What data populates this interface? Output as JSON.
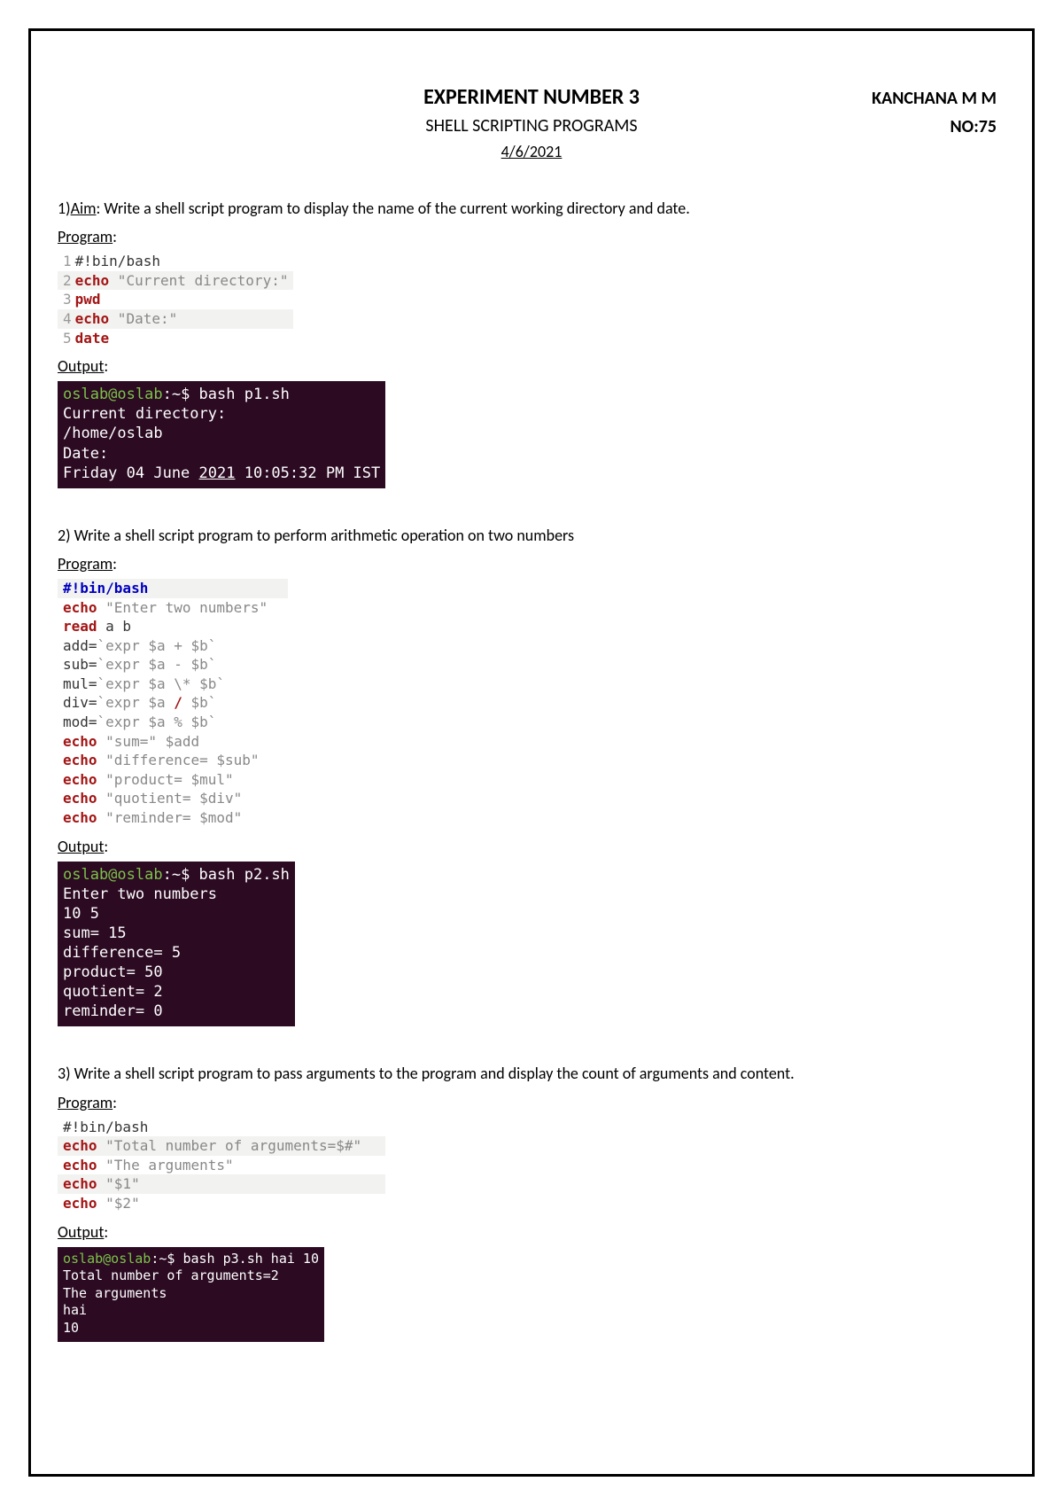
{
  "header": {
    "title": "EXPERIMENT NUMBER 3",
    "subtitle": "SHELL SCRIPTING PROGRAMS",
    "date": "4/6/2021",
    "student": "KANCHANA M M",
    "rollno": "NO:75"
  },
  "labels": {
    "program": "Program",
    "output": "Output",
    "aim_prefix": "Aim"
  },
  "q1": {
    "num": "1)",
    "text": ": Write a shell script program to display the name of the current working directory and date.",
    "code": {
      "l1_ln": "1",
      "l1": "#!bin/bash",
      "l2_ln": "2",
      "l2_kw": "echo",
      "l2_str": " \"Current directory:\"",
      "l3_ln": "3",
      "l3_kw": "pwd",
      "l4_ln": "4",
      "l4_kw": "echo",
      "l4_str": " \"Date:\"",
      "l5_ln": "5",
      "l5_kw": "date"
    },
    "term": {
      "prompt_user": "oslab@oslab",
      "prompt_path": ":~$",
      "cmd": " bash p1.sh",
      "l2": "Current directory:",
      "l3": "/home/oslab",
      "l4": "Date:",
      "l5a": "Friday 04 June ",
      "l5_year": "2021",
      "l5b": " 10:05:32 PM IST"
    }
  },
  "q2": {
    "num": "2)",
    "text": " Write a shell script program to perform arithmetic operation on two numbers",
    "code": {
      "l1": "#!bin/bash",
      "l2_kw": "echo",
      "l2_str": " \"Enter two numbers\"",
      "l3_kw": "read",
      "l3_str": " a b",
      "l4a": "add=",
      "l4b": "`expr $a + $b`",
      "l5a": "sub=",
      "l5b": "`expr $a - $b`",
      "l6a": "mul=",
      "l6b": "`expr $a \\* $b`",
      "l7a": "div=",
      "l7_b1": "`expr $a ",
      "l7_op": "/",
      "l7_b2": " $b`",
      "l8a": "mod=",
      "l8b": "`expr $a % $b`",
      "l9_kw": "echo",
      "l9_str": " \"sum=\" $add",
      "l10_kw": "echo",
      "l10_str": " \"difference= $sub\"",
      "l11_kw": "echo",
      "l11_str": " \"product= $mul\"",
      "l12_kw": "echo",
      "l12_str": " \"quotient= $div\"",
      "l13_kw": "echo",
      "l13_str": " \"reminder= $mod\""
    },
    "term": {
      "prompt_user": "oslab@oslab",
      "prompt_path": ":~$",
      "cmd": " bash p2.sh",
      "l2": "Enter two numbers",
      "l3": "10 5",
      "l4": "sum= 15",
      "l5": "difference= 5",
      "l6": "product= 50",
      "l7": "quotient= 2",
      "l8": "reminder= 0"
    }
  },
  "q3": {
    "num": "3)",
    "text": " Write a shell script program to pass arguments to the program and display the count of arguments and content.",
    "code": {
      "l1": "#!bin/bash",
      "l2_kw": "echo",
      "l2_str": " \"Total number of arguments=$#\"",
      "l3_kw": "echo",
      "l3_str": " \"The arguments\"",
      "l4_kw": "echo",
      "l4_str": " \"$1\"",
      "l5_kw": "echo",
      "l5_str": " \"$2\""
    },
    "term": {
      "prompt_user": "oslab@oslab",
      "prompt_path": ":~$",
      "cmd": " bash p3.sh hai 10",
      "l2": "Total number of arguments=2",
      "l3": "The arguments",
      "l4": "hai",
      "l5": "10"
    }
  }
}
